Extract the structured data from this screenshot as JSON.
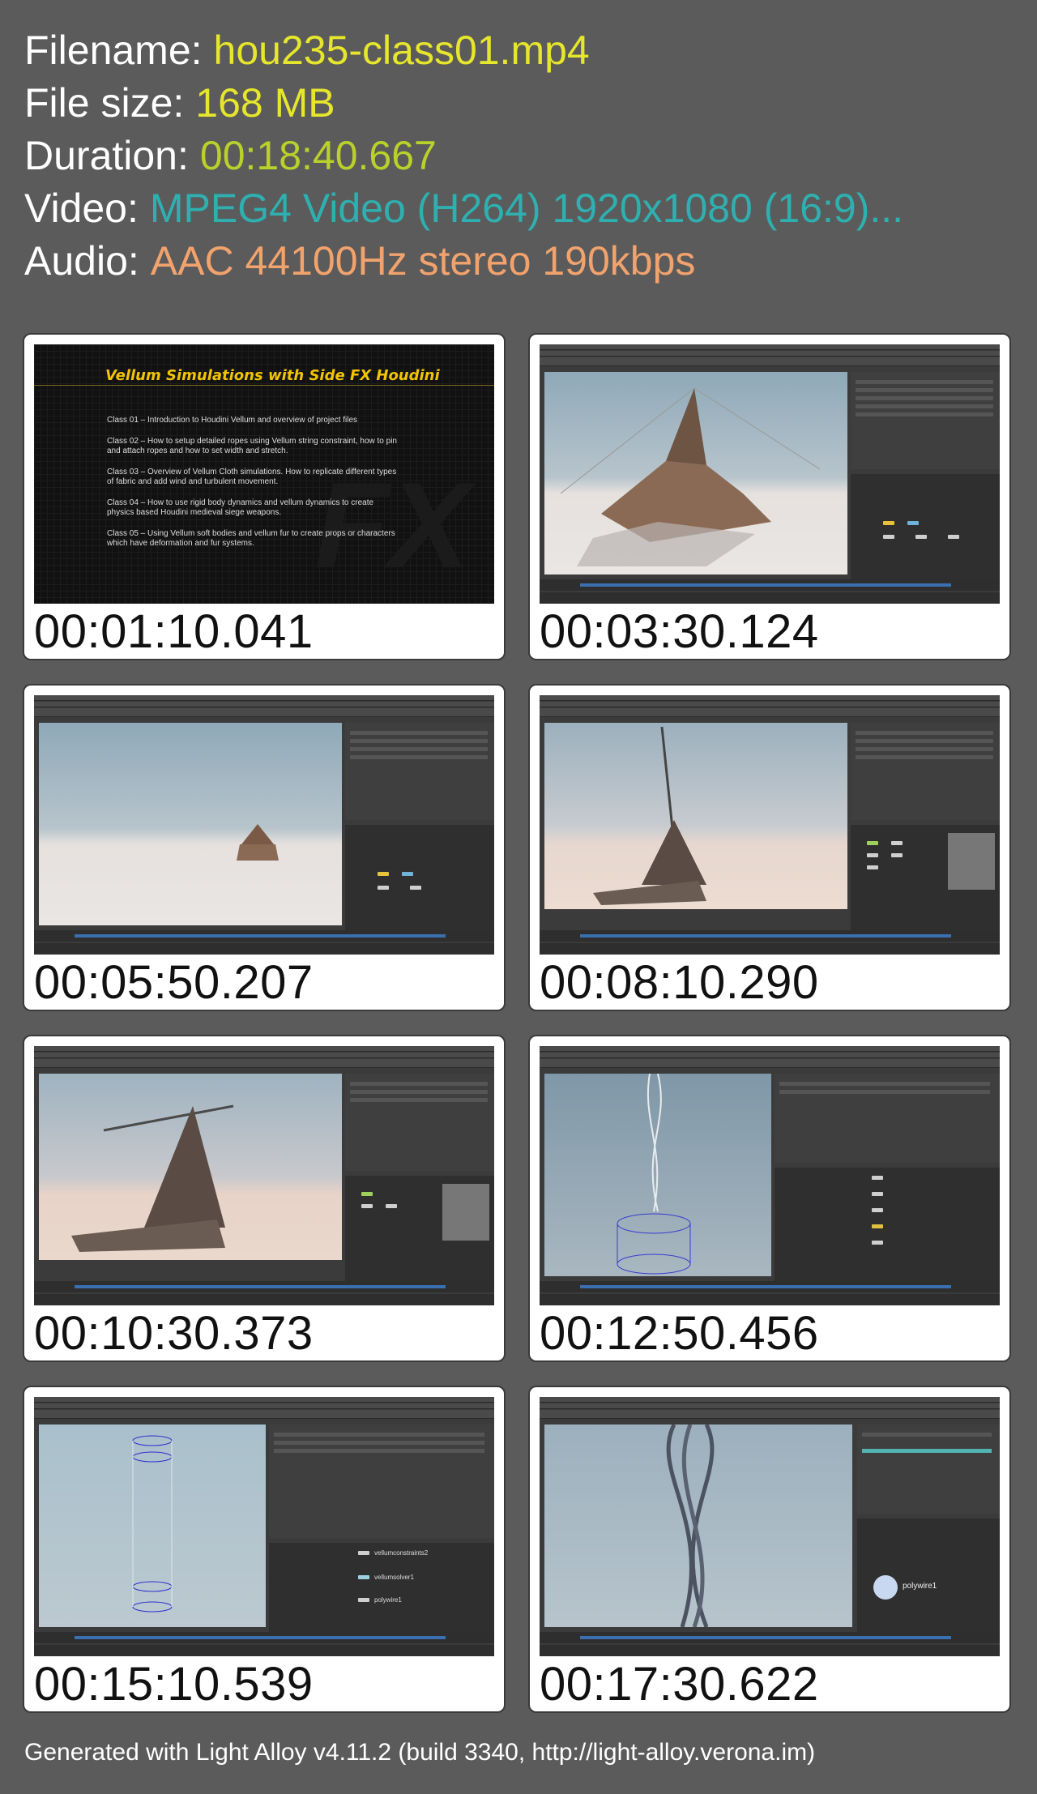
{
  "info": {
    "filename_label": "Filename:",
    "filename_value": "hou235-class01.mp4",
    "size_label": "File size:",
    "size_value": "168 MB",
    "duration_label": "Duration:",
    "duration_value": "00:18:40.667",
    "video_label": "Video:",
    "video_value": "MPEG4 Video (H264) 1920x1080 (16:9)...",
    "audio_label": "Audio:",
    "audio_value": "AAC 44100Hz stereo 190kbps"
  },
  "colors": {
    "background": "#5b5b5b",
    "filename": "#e6e62c",
    "size": "#e6e62c",
    "duration": "#b9d12b",
    "video": "#2fb0b0",
    "audio": "#f2a36d"
  },
  "slide": {
    "title": "Vellum Simulations with Side FX Houdini",
    "items": [
      "Class 01 – Introduction to Houdini Vellum and overview of project files",
      "Class 02 – How to setup detailed ropes using Vellum string constraint, how to pin and attach ropes and how to set width and stretch.",
      "Class 03 – Overview of Vellum Cloth simulations. How to replicate different types of fabric and add wind and turbulent movement.",
      "Class 04 – How to use rigid body dynamics and vellum dynamics to create physics based Houdini medieval siege weapons.",
      "Class 05 – Using Vellum soft bodies and vellum fur to create props or characters which have deformation and fur systems."
    ]
  },
  "thumbnails": [
    {
      "timestamp": "00:01:10.041"
    },
    {
      "timestamp": "00:03:30.124"
    },
    {
      "timestamp": "00:05:50.207"
    },
    {
      "timestamp": "00:08:10.290"
    },
    {
      "timestamp": "00:10:30.373"
    },
    {
      "timestamp": "00:12:50.456"
    },
    {
      "timestamp": "00:15:10.539"
    },
    {
      "timestamp": "00:17:30.622"
    }
  ],
  "node_labels": {
    "t7_a": "vellumconstraints2",
    "t7_b": "vellumsolver1",
    "t7_c": "polywire1",
    "t8": "polywire1"
  },
  "footer": "Generated with Light Alloy v4.11.2 (build 3340, http://light-alloy.verona.im)"
}
